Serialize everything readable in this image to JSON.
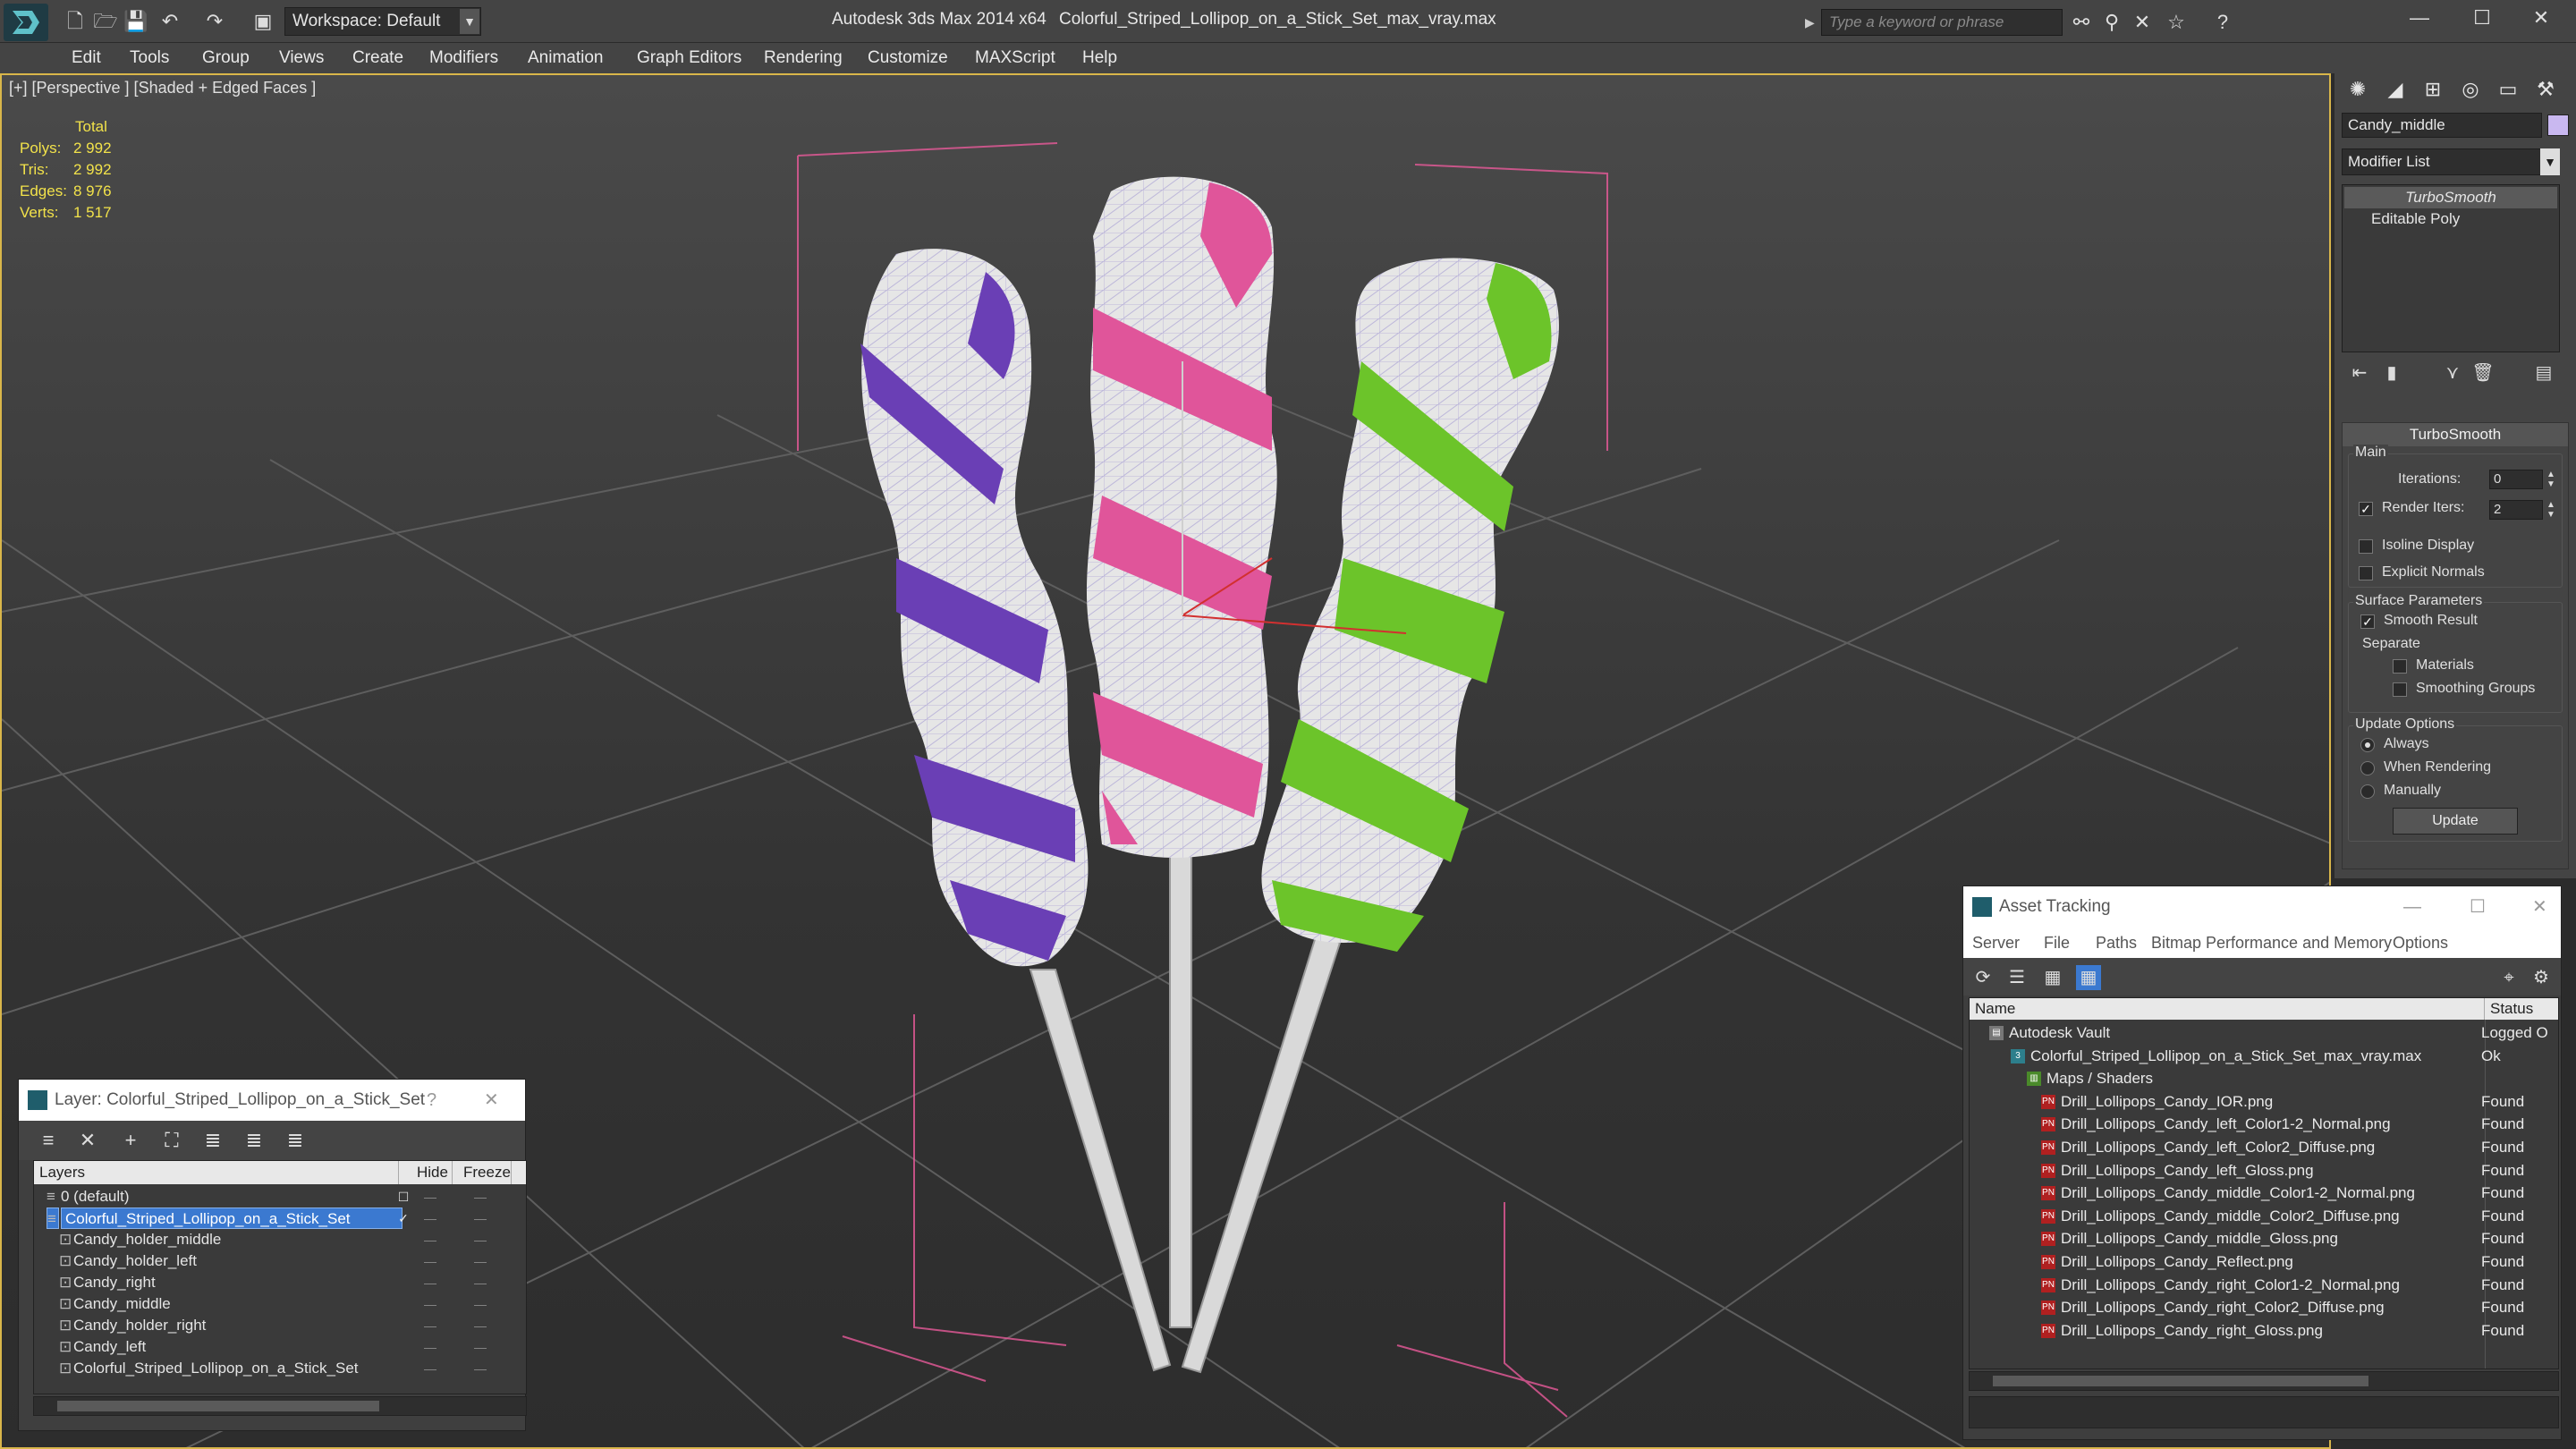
{
  "titlebar": {
    "workspace": "Workspace: Default",
    "app_title": "Autodesk 3ds Max  2014 x64",
    "file_title": "Colorful_Striped_Lollipop_on_a_Stick_Set_max_vray.max",
    "search_placeholder": "Type a keyword or phrase"
  },
  "menu": [
    "Edit",
    "Tools",
    "Group",
    "Views",
    "Create",
    "Modifiers",
    "Animation",
    "Graph Editors",
    "Rendering",
    "Customize",
    "MAXScript",
    "Help"
  ],
  "viewport": {
    "label": "[+] [Perspective ] [Shaded + Edged Faces ]",
    "stats": {
      "header": "Total",
      "rows": [
        {
          "key": "Polys:",
          "value": "2 992"
        },
        {
          "key": "Tris:",
          "value": "2 992"
        },
        {
          "key": "Edges:",
          "value": "8 976"
        },
        {
          "key": "Verts:",
          "value": "1 517"
        }
      ]
    },
    "colors": {
      "purple": "#6a3fb5",
      "pink": "#e0559a",
      "green": "#6cc42a",
      "white": "#e6e6e6"
    }
  },
  "layer_dialog": {
    "title": "Layer: Colorful_Striped_Lollipop_on_a_Stick_Set",
    "question": "?",
    "close": "✕",
    "columns": {
      "layers": "Layers",
      "hide": "Hide",
      "freeze": "Freeze"
    },
    "rows": [
      {
        "name": "0 (default)",
        "indent": 1,
        "selected": false
      },
      {
        "name": "Colorful_Striped_Lollipop_on_a_Stick_Set",
        "indent": 1,
        "selected": true
      },
      {
        "name": "Candy_holder_middle",
        "indent": 2,
        "selected": false
      },
      {
        "name": "Candy_holder_left",
        "indent": 2,
        "selected": false
      },
      {
        "name": "Candy_right",
        "indent": 2,
        "selected": false
      },
      {
        "name": "Candy_middle",
        "indent": 2,
        "selected": false
      },
      {
        "name": "Candy_holder_right",
        "indent": 2,
        "selected": false
      },
      {
        "name": "Candy_left",
        "indent": 2,
        "selected": false
      },
      {
        "name": "Colorful_Striped_Lollipop_on_a_Stick_Set",
        "indent": 2,
        "selected": false
      }
    ]
  },
  "command_panel": {
    "object_name": "Candy_middle",
    "modifier_list": "Modifier List",
    "stack": [
      "TurboSmooth",
      "Editable Poly"
    ],
    "rollout_title": "TurboSmooth",
    "main_label": "Main",
    "iterations_label": "Iterations:",
    "iterations_value": "0",
    "render_iters_label": "Render Iters:",
    "render_iters_value": "2",
    "isoline": "Isoline Display",
    "explicit_normals": "Explicit Normals",
    "surface_params": "Surface Parameters",
    "smooth_result": "Smooth Result",
    "separate": "Separate",
    "materials": "Materials",
    "smoothing_groups": "Smoothing Groups",
    "update_options": "Update Options",
    "always": "Always",
    "when_rendering": "When Rendering",
    "manually": "Manually",
    "update_button": "Update"
  },
  "asset_tracking": {
    "title": "Asset Tracking",
    "menu": [
      "Server",
      "File",
      "Paths",
      "Bitmap Performance and Memory",
      "Options"
    ],
    "columns": {
      "name": "Name",
      "status": "Status"
    },
    "rows": [
      {
        "name": "Autodesk Vault",
        "status": "Logged O",
        "level": 0,
        "icon": "vault"
      },
      {
        "name": "Colorful_Striped_Lollipop_on_a_Stick_Set_max_vray.max",
        "status": "Ok",
        "level": 1,
        "icon": "file"
      },
      {
        "name": "Maps / Shaders",
        "status": "",
        "level": 2,
        "icon": "folder"
      },
      {
        "name": "Drill_Lollipops_Candy_IOR.png",
        "status": "Found",
        "level": 3,
        "icon": "png"
      },
      {
        "name": "Drill_Lollipops_Candy_left_Color1-2_Normal.png",
        "status": "Found",
        "level": 3,
        "icon": "png"
      },
      {
        "name": "Drill_Lollipops_Candy_left_Color2_Diffuse.png",
        "status": "Found",
        "level": 3,
        "icon": "png"
      },
      {
        "name": "Drill_Lollipops_Candy_left_Gloss.png",
        "status": "Found",
        "level": 3,
        "icon": "png"
      },
      {
        "name": "Drill_Lollipops_Candy_middle_Color1-2_Normal.png",
        "status": "Found",
        "level": 3,
        "icon": "png"
      },
      {
        "name": "Drill_Lollipops_Candy_middle_Color2_Diffuse.png",
        "status": "Found",
        "level": 3,
        "icon": "png"
      },
      {
        "name": "Drill_Lollipops_Candy_middle_Gloss.png",
        "status": "Found",
        "level": 3,
        "icon": "png"
      },
      {
        "name": "Drill_Lollipops_Candy_Reflect.png",
        "status": "Found",
        "level": 3,
        "icon": "png"
      },
      {
        "name": "Drill_Lollipops_Candy_right_Color1-2_Normal.png",
        "status": "Found",
        "level": 3,
        "icon": "png"
      },
      {
        "name": "Drill_Lollipops_Candy_right_Color2_Diffuse.png",
        "status": "Found",
        "level": 3,
        "icon": "png"
      },
      {
        "name": "Drill_Lollipops_Candy_right_Gloss.png",
        "status": "Found",
        "level": 3,
        "icon": "png"
      }
    ]
  }
}
